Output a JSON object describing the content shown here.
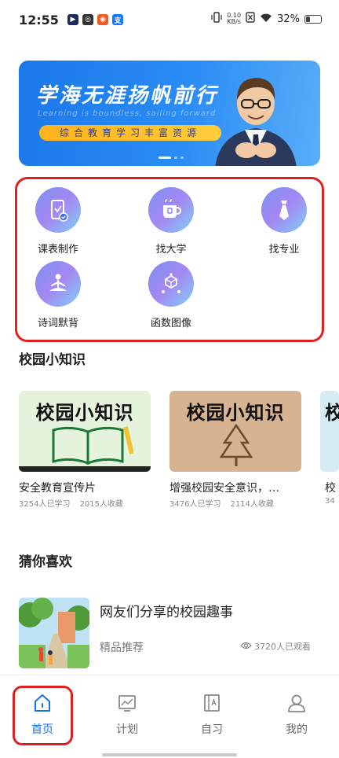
{
  "status_bar": {
    "time": "12:55",
    "net_speed_value": "0.10",
    "net_speed_unit": "KB/s",
    "battery": "32%",
    "battery_level": 0.32
  },
  "banner": {
    "title": "学海无涯扬帆前行",
    "subtitle": "Learning is boundless, sailing forward",
    "tag": "综合教育学习丰富资源",
    "active_slide": 1,
    "slide_count": 3
  },
  "tools": [
    {
      "label": "课表制作",
      "icon": "schedule-phone-icon"
    },
    {
      "label": "找大学",
      "icon": "cup-icon"
    },
    {
      "label": "找专业",
      "icon": "tie-icon"
    },
    {
      "label": "诗词默背",
      "icon": "meditation-icon"
    },
    {
      "label": "函数图像",
      "icon": "cube-graph-icon"
    }
  ],
  "sections": {
    "campus_knowledge": "校园小知识",
    "recommend": "猜你喜欢"
  },
  "knowledge_cards": [
    {
      "thumb_text": "校园小知识",
      "title": "安全教育宣传片",
      "learners": "3254人已学习",
      "favorites": "2015人收藏"
    },
    {
      "thumb_text": "校园小知识",
      "title": "增强校园安全意识，…",
      "learners": "3476人已学习",
      "favorites": "2114人收藏"
    },
    {
      "thumb_text": "校",
      "title": "校",
      "learners": "34",
      "favorites": ""
    }
  ],
  "recommend_item": {
    "title": "网友们分享的校园趣事",
    "tag": "精品推荐",
    "views": "3720人已观看"
  },
  "bottom_nav": [
    {
      "label": "首页",
      "icon": "home-icon",
      "active": true
    },
    {
      "label": "计划",
      "icon": "chart-board-icon",
      "active": false
    },
    {
      "label": "自习",
      "icon": "book-icon",
      "active": false
    },
    {
      "label": "我的",
      "icon": "user-icon",
      "active": false
    }
  ],
  "colors": {
    "accent": "#1a6ff0",
    "highlight_border": "#e02020",
    "banner_blue": "#1a78e8",
    "banner_tag": "#ffb21e"
  }
}
